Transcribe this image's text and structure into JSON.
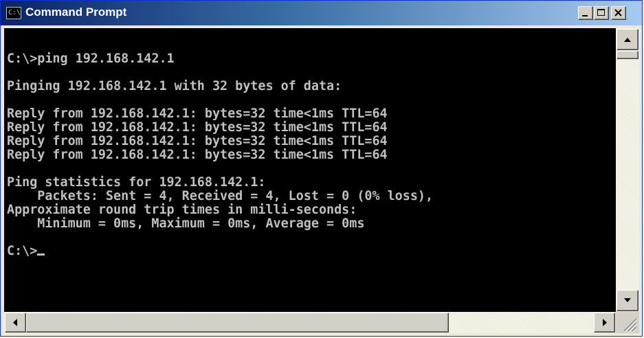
{
  "window": {
    "title": "Command Prompt",
    "icon_label": "C:\\"
  },
  "console": {
    "lines": [
      "C:\\>ping 192.168.142.1",
      "",
      "Pinging 192.168.142.1 with 32 bytes of data:",
      "",
      "Reply from 192.168.142.1: bytes=32 time<1ms TTL=64",
      "Reply from 192.168.142.1: bytes=32 time<1ms TTL=64",
      "Reply from 192.168.142.1: bytes=32 time<1ms TTL=64",
      "Reply from 192.168.142.1: bytes=32 time<1ms TTL=64",
      "",
      "Ping statistics for 192.168.142.1:",
      "    Packets: Sent = 4, Received = 4, Lost = 0 (0% loss),",
      "Approximate round trip times in milli-seconds:",
      "    Minimum = 0ms, Maximum = 0ms, Average = 0ms",
      ""
    ],
    "prompt": "C:\\>"
  },
  "colors": {
    "titlebar_start": "#0a246a",
    "titlebar_end": "#a6caf0",
    "console_bg": "#000000",
    "console_fg": "#c0c0c0"
  },
  "icons": [
    "console-window-icon",
    "minimize-icon",
    "maximize-icon",
    "close-icon",
    "arrow-up-icon",
    "arrow-down-icon",
    "arrow-left-icon",
    "arrow-right-icon",
    "resize-grip-icon"
  ]
}
